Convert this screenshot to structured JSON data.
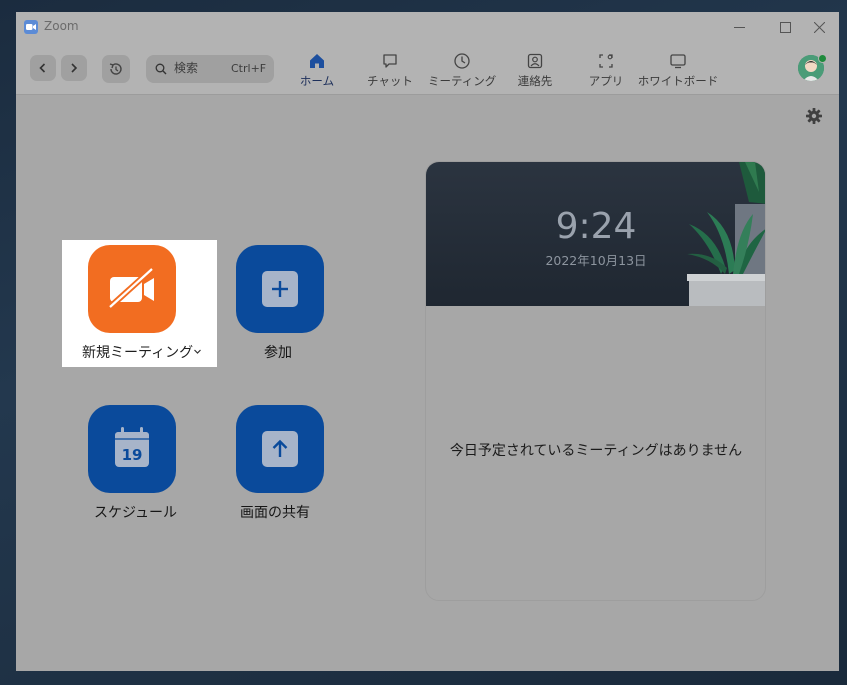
{
  "titlebar": {
    "app_title": "Zoom",
    "minimize_icon": "minimize-icon",
    "maximize_icon": "maximize-icon",
    "close_icon": "close-icon"
  },
  "toolbar": {
    "search": {
      "placeholder": "検索",
      "shortcut": "Ctrl+F"
    },
    "tabs": [
      {
        "label": "ホーム",
        "icon": "home-icon",
        "active": true
      },
      {
        "label": "チャット",
        "icon": "chat-icon"
      },
      {
        "label": "ミーティング",
        "icon": "clock-icon"
      },
      {
        "label": "連絡先",
        "icon": "contact-icon"
      },
      {
        "label": "アプリ",
        "icon": "apps-icon"
      },
      {
        "label": "ホワイトボード",
        "icon": "whiteboard-icon"
      }
    ],
    "status_color": "#1e8a3c",
    "accent_color": "#0b5cff"
  },
  "actions": {
    "new_meeting": "新規ミーティング",
    "join": "参加",
    "schedule": "スケジュール",
    "schedule_day": "19",
    "share_screen": "画面の共有"
  },
  "panel": {
    "time": "9:24",
    "date": "2022年10月13日",
    "empty_message": "今日予定されているミーティングはありません"
  }
}
